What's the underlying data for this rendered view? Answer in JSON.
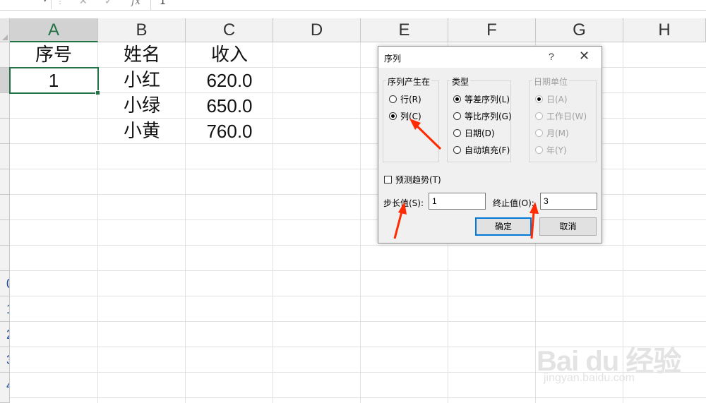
{
  "formula_bar": {
    "fx_label": "fx",
    "formula_value": "1",
    "cancel_glyph": "✕",
    "enter_glyph": "✓",
    "more_glyph": "⋮",
    "dropdown_glyph": "▾"
  },
  "sheet": {
    "columns": [
      "A",
      "B",
      "C",
      "D",
      "E",
      "F",
      "G",
      "H"
    ],
    "selected_column": "A",
    "row_header_fragments": [
      "0",
      "1",
      "2",
      "3",
      "4"
    ],
    "cells": {
      "A1": "序号",
      "B1": "姓名",
      "C1": "收入",
      "A2": "1",
      "B2": "小红",
      "C2": "620.0",
      "B3": "小绿",
      "C3": "650.0",
      "B4": "小黄",
      "C4": "760.0"
    },
    "active_cell": "A2"
  },
  "dialog": {
    "title": "序列",
    "help_glyph": "?",
    "close_glyph": "✕",
    "series_in": {
      "label": "序列产生在",
      "options": [
        {
          "label": "行(R)",
          "selected": false
        },
        {
          "label": "列(C)",
          "selected": true
        }
      ]
    },
    "type": {
      "label": "类型",
      "options": [
        {
          "label": "等差序列(L)",
          "selected": true
        },
        {
          "label": "等比序列(G)",
          "selected": false
        },
        {
          "label": "日期(D)",
          "selected": false
        },
        {
          "label": "自动填充(F)",
          "selected": false
        }
      ]
    },
    "date_unit": {
      "label": "日期单位",
      "disabled": true,
      "options": [
        {
          "label": "日(A)",
          "selected": true
        },
        {
          "label": "工作日(W)",
          "selected": false
        },
        {
          "label": "月(M)",
          "selected": false
        },
        {
          "label": "年(Y)",
          "selected": false
        }
      ]
    },
    "trend": {
      "label": "预测趋势(T)",
      "checked": false
    },
    "step": {
      "label": "步长值(S):",
      "value": "1"
    },
    "stop": {
      "label": "终止值(O):",
      "value": "3"
    },
    "ok_label": "确定",
    "cancel_label": "取消"
  },
  "annotations": {
    "arrow_color": "#ff2a00",
    "arrow_count": 3
  },
  "watermark": {
    "logo_text": "Bai du 经验",
    "url_text": "jingyan.baidu.com"
  }
}
